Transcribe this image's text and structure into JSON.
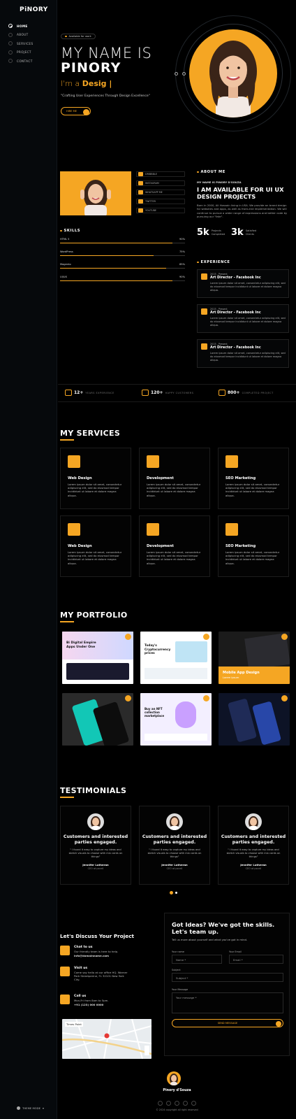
{
  "brand": "PiNORY",
  "nav": [
    "HOME",
    "ABOUT",
    "SERVICES",
    "PROJECT",
    "CONTACT"
  ],
  "theme_label": "THEME MODE",
  "hero": {
    "badge": "Available for work",
    "line1": "MY NAME IS",
    "line2": "PINORY",
    "role_prefix": "I'm a",
    "role_word": "Desig |",
    "tagline": "\"Crafting User Experiences Through Design Excellence\"",
    "hire": "HIRE ME"
  },
  "socials": [
    "DRIBBBLE",
    "INSTAGRAM",
    "WHATSAPP ME",
    "TWITTER",
    "YOUTUBE"
  ],
  "skills": {
    "title": "SKILLS",
    "items": [
      {
        "name": "HTML 5",
        "pct": "90%",
        "value": 90
      },
      {
        "name": "WordPress",
        "pct": "75%",
        "value": 75
      },
      {
        "name": "Magento",
        "pct": "85%",
        "value": 85
      },
      {
        "name": "UI/UX",
        "pct": "90%",
        "value": 90
      }
    ]
  },
  "about": {
    "title": "ABOUT ME",
    "name": "MY NAME IS PINORY D'SOUZA",
    "heading": "I AM AVAILABLE FOR UI UX DESIGN PROJECTS",
    "text": "Born in 2000, Ali Hossain living in USA. We provide an brand design for websites and apps, as well as front-end implementation. We will continue to pursue a wider range of expressions and better code by pursuing our \"fate\".",
    "stat1": "5k",
    "stat1_label": "Projects Completed",
    "stat2": "3k",
    "stat2_label": "Satisfied Clients"
  },
  "experience": {
    "title": "EXPERIENCE",
    "items": [
      {
        "years": "2015 - Present",
        "title": "Art Director - Facebook Inc",
        "desc": "Lorem ipsum dolor sit amet, consectetur adipiscing elit, sed do eiusmod tempor incididunt ut labore et dolore magna aliqua."
      },
      {
        "years": "2015 - Present",
        "title": "Art Director - Facebook Inc",
        "desc": "Lorem ipsum dolor sit amet, consectetur adipiscing elit, sed do eiusmod tempor incididunt ut labore et dolore magna aliqua."
      },
      {
        "years": "2015 - Present",
        "title": "Art Director - Facebook Inc",
        "desc": "Lorem ipsum dolor sit amet, consectetur adipiscing elit, sed do eiusmod tempor incididunt ut labore et dolore magna aliqua."
      }
    ]
  },
  "counters": [
    {
      "num": "12+",
      "label": "YEARS EXPERIENCE"
    },
    {
      "num": "120+",
      "label": "HAPPY CUSTOMERS"
    },
    {
      "num": "800+",
      "label": "COMPLETED PROJECT"
    }
  ],
  "services": {
    "title": "MY SERVICES",
    "items": [
      {
        "t": "Web Design",
        "d": "Lorem ipsum dolor sit amet, consectetur adipiscing elit, sed do eiusmod tempor incididunt ut labore et dolore magna aliqua."
      },
      {
        "t": "Development",
        "d": "Lorem ipsum dolor sit amet, consectetur adipiscing elit, sed do eiusmod tempor incididunt ut labore et dolore magna aliqua."
      },
      {
        "t": "SEO Marketing",
        "d": "Lorem ipsum dolor sit amet, consectetur adipiscing elit, sed do eiusmod tempor incididunt ut labore et dolore magna aliqua."
      },
      {
        "t": "Web Design",
        "d": "Lorem ipsum dolor sit amet, consectetur adipiscing elit, sed do eiusmod tempor incididunt ut labore et dolore magna aliqua."
      },
      {
        "t": "Development",
        "d": "Lorem ipsum dolor sit amet, consectetur adipiscing elit, sed do eiusmod tempor incididunt ut labore et dolore magna aliqua."
      },
      {
        "t": "SEO Marketing",
        "d": "Lorem ipsum dolor sit amet, consectetur adipiscing elit, sed do eiusmod tempor incididunt ut labore et dolore magna aliqua."
      }
    ]
  },
  "portfolio": {
    "title": "MY PORTFOLIO",
    "p1": "Bi Digital Empire Apps Under One",
    "p2": "Today's Cryptocurrency prices",
    "p3": "Mobile App Design",
    "p3_sub": "Lorem ipsum",
    "p5": "Buy an NFT collection marketplace"
  },
  "testimonials": {
    "title": "TESTIMONIALS",
    "items": [
      {
        "t": "Customers and interested parties engaged.",
        "q": "\" I found it easy to capture my ideas and sketch visuals to choose with mix cards on things\"",
        "n": "Jennifer Lutheran",
        "r": "CEO at pxcell"
      },
      {
        "t": "Customers and interested parties engaged.",
        "q": "\" I found it easy to capture my ideas and sketch visuals to choose with mix cards on things\"",
        "n": "Jennifer Lutheran",
        "r": "CEO at pxcell"
      },
      {
        "t": "Customers and interested parties engaged.",
        "q": "\" I found it easy to capture my ideas and sketch visuals to choose with mix cards on things\"",
        "n": "Jennifer Lutheran",
        "r": "CEO at pxcell"
      }
    ]
  },
  "contact": {
    "title": "Let's Discuss Your Project",
    "chat_t": "Chat to us",
    "chat_d": "Our friendly team is here to help.",
    "chat_e": "info@domainname.com",
    "visit_t": "Visit us",
    "visit_d": "Come say hello at our office HQ. Warner Park Streetperine, FL 32101 New York City.",
    "call_t": "Call us",
    "call_d": "Mon-Fri from 8am to 5pm.",
    "call_p": "+91 (123) 000 0000",
    "map_label": "Times Point"
  },
  "form": {
    "title": "Got Ideas? We've got the skills. Let's team up.",
    "sub": "Tell us more about yourself and what you've got in mind.",
    "l_name": "Your name",
    "l_email": "Your Email",
    "l_subject": "Subject",
    "l_msg": "Your Message",
    "p_name": "Name *",
    "p_email": "Email *",
    "p_subject": "Subject *",
    "p_msg": "Your message *",
    "send": "SEND MESSAGE"
  },
  "footer": {
    "name": "Pinory d'Souza",
    "copy": "© 2024 copyright all right reserved",
    "icons": [
      "f",
      "t",
      "ig",
      "in",
      "p"
    ]
  },
  "accent": "#f5a623"
}
